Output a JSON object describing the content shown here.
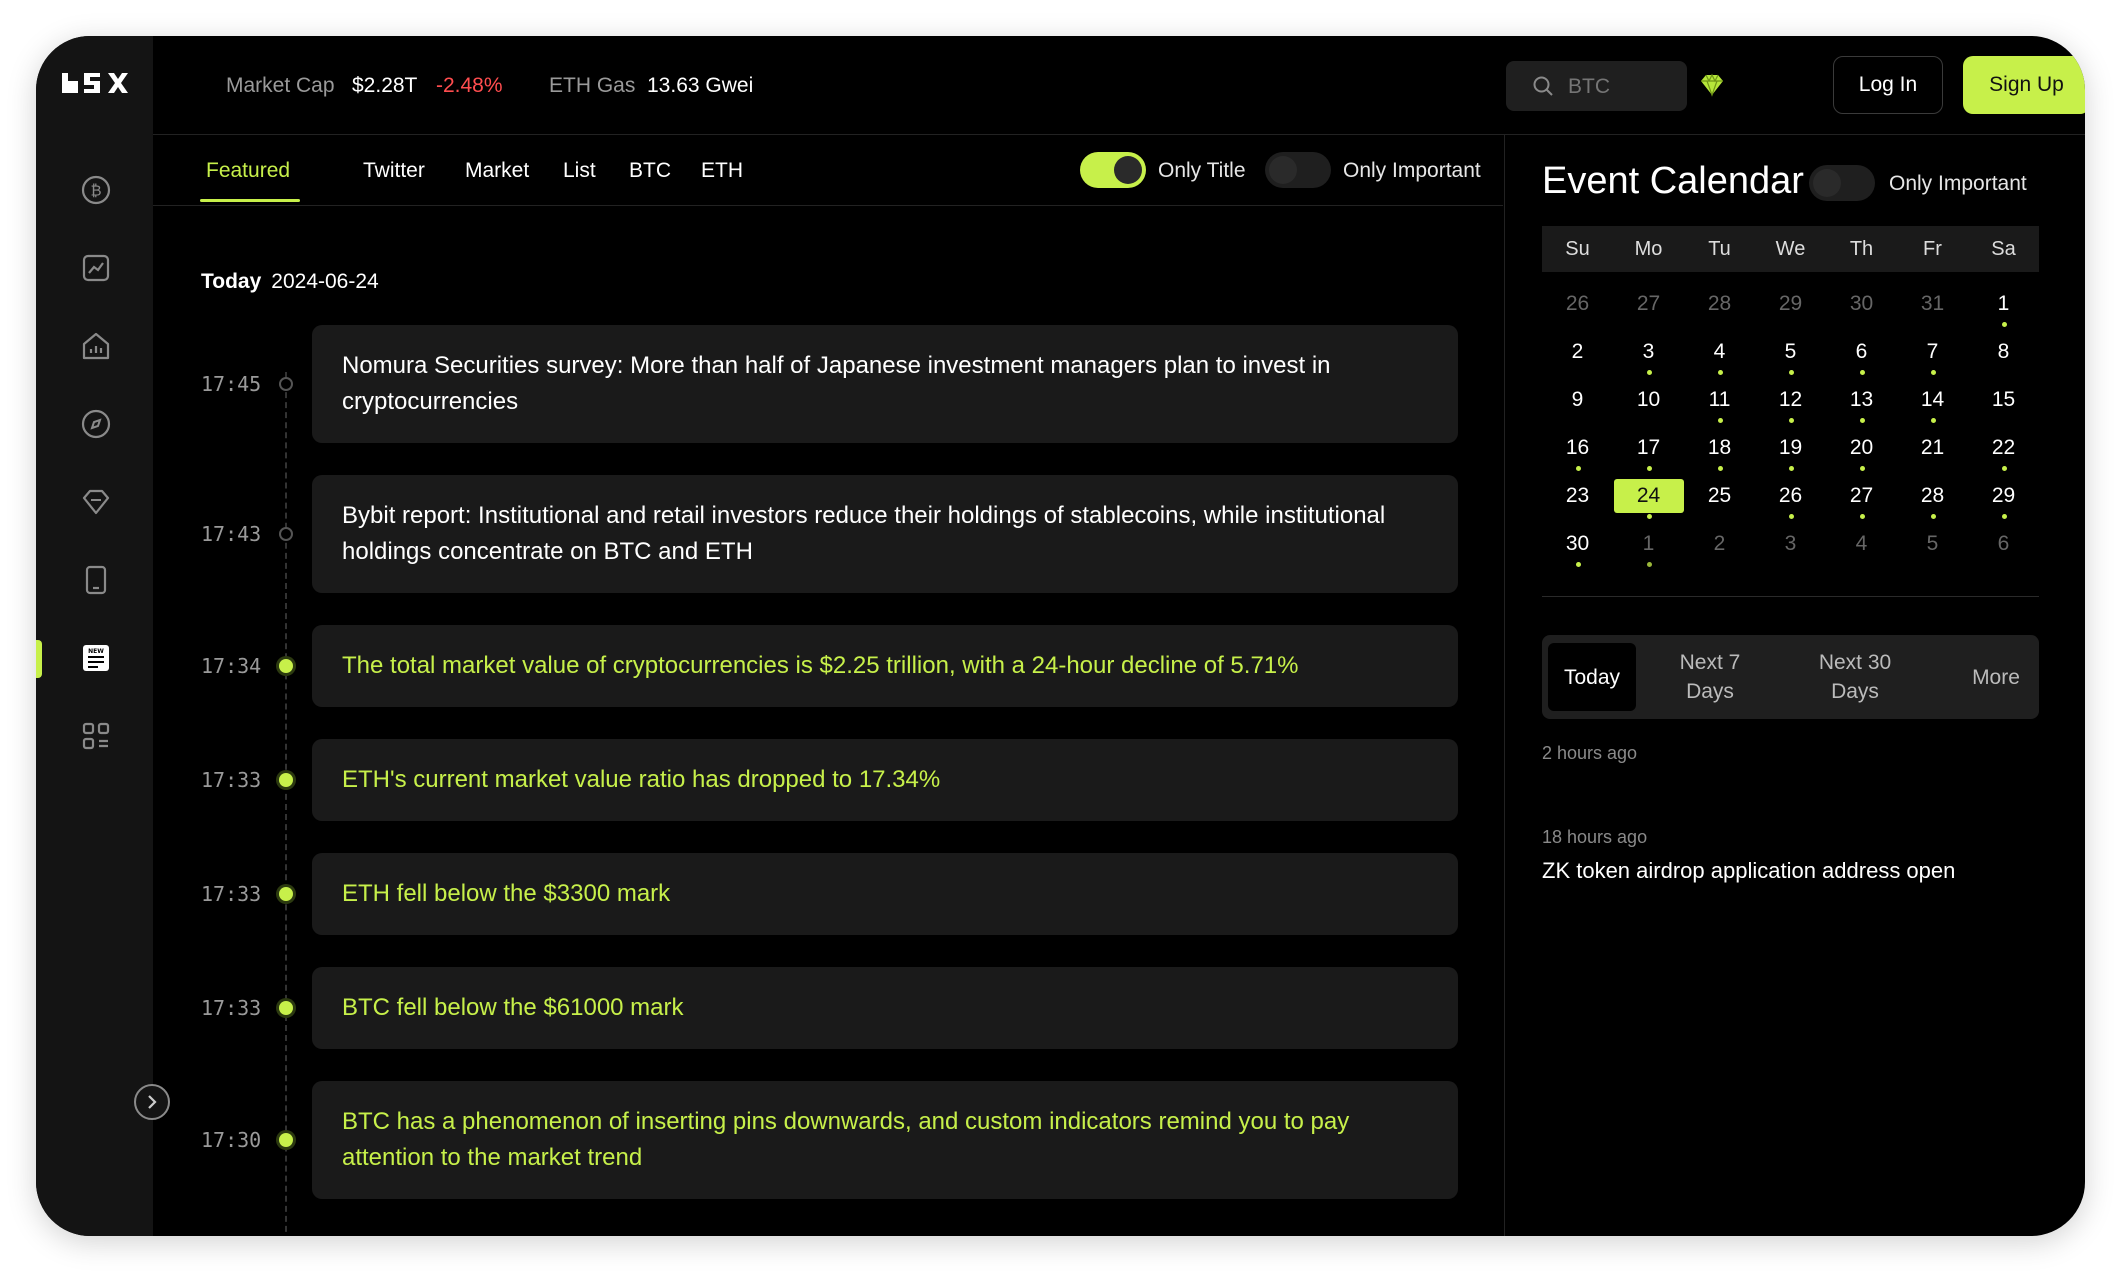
{
  "header": {
    "market_cap_label": "Market Cap",
    "market_cap_value": "$2.28T",
    "market_cap_change": "-2.48%",
    "eth_gas_label": "ETH Gas",
    "eth_gas_value": "13.63 Gwei",
    "search_placeholder": "BTC",
    "login_label": "Log In",
    "signup_label": "Sign Up"
  },
  "sidebar": {
    "icons": [
      "bitcoin-icon",
      "chart-icon",
      "home-chart-icon",
      "compass-icon",
      "diamond-icon",
      "tablet-icon",
      "news-icon",
      "apps-icon"
    ],
    "active_index": 6
  },
  "tabs": [
    "Featured",
    "Twitter",
    "Market",
    "List",
    "BTC",
    "ETH"
  ],
  "filters": {
    "only_title_label": "Only Title",
    "only_title_on": true,
    "only_important_label": "Only Important",
    "only_important_on": false
  },
  "feed": {
    "day_label": "Today",
    "date": "2024-06-24",
    "items": [
      {
        "time": "17:45",
        "text": "Nomura Securities survey: More than half of Japanese investment managers plan to invest in cryptocurrencies",
        "important": false
      },
      {
        "time": "17:43",
        "text": "Bybit report: Institutional and retail investors reduce their holdings of stablecoins, while institutional holdings concentrate on BTC and ETH",
        "important": false
      },
      {
        "time": "17:34",
        "text": "The total market value of cryptocurrencies is $2.25 trillion, with a 24-hour decline of 5.71%",
        "important": true
      },
      {
        "time": "17:33",
        "text": "ETH's current market value ratio has dropped to 17.34%",
        "important": true
      },
      {
        "time": "17:33",
        "text": "ETH fell below the $3300 mark",
        "important": true
      },
      {
        "time": "17:33",
        "text": "BTC fell below the $61000 mark",
        "important": true
      },
      {
        "time": "17:30",
        "text": "BTC has a phenomenon of inserting pins downwards, and custom indicators remind you to pay attention to the market trend",
        "important": true
      }
    ]
  },
  "calendar": {
    "title": "Event Calendar",
    "only_important_label": "Only Important",
    "weekdays": [
      "Su",
      "Mo",
      "Tu",
      "We",
      "Th",
      "Fr",
      "Sa"
    ],
    "weeks": [
      [
        {
          "d": "26",
          "dim": true
        },
        {
          "d": "27",
          "dim": true
        },
        {
          "d": "28",
          "dim": true
        },
        {
          "d": "29",
          "dim": true
        },
        {
          "d": "30",
          "dim": true
        },
        {
          "d": "31",
          "dim": true
        },
        {
          "d": "1",
          "ev": true
        }
      ],
      [
        {
          "d": "2"
        },
        {
          "d": "3",
          "ev": true
        },
        {
          "d": "4",
          "ev": true
        },
        {
          "d": "5",
          "ev": true
        },
        {
          "d": "6",
          "ev": true
        },
        {
          "d": "7",
          "ev": true
        },
        {
          "d": "8"
        }
      ],
      [
        {
          "d": "9"
        },
        {
          "d": "10"
        },
        {
          "d": "11",
          "ev": true
        },
        {
          "d": "12",
          "ev": true
        },
        {
          "d": "13",
          "ev": true
        },
        {
          "d": "14",
          "ev": true
        },
        {
          "d": "15"
        }
      ],
      [
        {
          "d": "16",
          "ev": true
        },
        {
          "d": "17",
          "ev": true
        },
        {
          "d": "18",
          "ev": true
        },
        {
          "d": "19",
          "ev": true
        },
        {
          "d": "20",
          "ev": true
        },
        {
          "d": "21"
        },
        {
          "d": "22",
          "ev": true
        }
      ],
      [
        {
          "d": "23"
        },
        {
          "d": "24",
          "ev": true,
          "sel": true
        },
        {
          "d": "25"
        },
        {
          "d": "26",
          "ev": true
        },
        {
          "d": "27",
          "ev": true
        },
        {
          "d": "28",
          "ev": true
        },
        {
          "d": "29",
          "ev": true
        }
      ],
      [
        {
          "d": "30",
          "ev": true
        },
        {
          "d": "1",
          "dim": true,
          "ev": true
        },
        {
          "d": "2",
          "dim": true
        },
        {
          "d": "3",
          "dim": true
        },
        {
          "d": "4",
          "dim": true
        },
        {
          "d": "5",
          "dim": true
        },
        {
          "d": "6",
          "dim": true
        }
      ]
    ],
    "ranges": [
      "Today",
      "Next 7 Days",
      "Next 30 Days",
      "More"
    ],
    "active_range": 0,
    "events": [
      {
        "ago": "2 hours ago",
        "title": ""
      },
      {
        "ago": "18 hours ago",
        "title": "ZK token airdrop application address open"
      }
    ]
  },
  "colors": {
    "accent": "#c7f04a",
    "negative": "#ff4d4f",
    "background": "#000000"
  }
}
